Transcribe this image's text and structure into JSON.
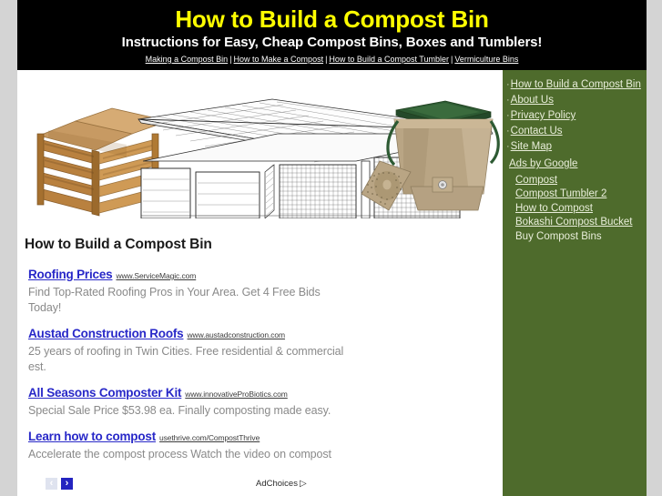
{
  "header": {
    "title": "How to Build a Compost Bin",
    "subtitle": "Instructions for Easy, Cheap Compost Bins, Boxes and Tumblers!",
    "nav": [
      {
        "label": "Making a Compost Bin"
      },
      {
        "label": "How to Make a Compost"
      },
      {
        "label": "How to Build a Compost Tumbler"
      },
      {
        "label": "Vermiculture Bins"
      }
    ],
    "nav_separator": "|",
    "title_color": "#ffff00",
    "background_color": "#000000"
  },
  "sidebar": {
    "background_color": "#4e6b2c",
    "bullet": "·",
    "links": [
      {
        "label": "How to Build a Compost Bin"
      },
      {
        "label": "About Us"
      },
      {
        "label": "Privacy Policy"
      },
      {
        "label": "Contact Us"
      },
      {
        "label": "Site Map"
      }
    ],
    "ads_heading": "Ads by Google",
    "ad_links": [
      {
        "label": "Compost",
        "underlined": true
      },
      {
        "label": "Compost Tumbler 2",
        "underlined": true
      },
      {
        "label": "How to Compost",
        "underlined": true
      },
      {
        "label": "Bokashi Compost Bucket",
        "underlined": true
      },
      {
        "label": "Buy Compost Bins",
        "underlined": false
      }
    ]
  },
  "main": {
    "page_title": "How to Build a Compost Bin",
    "banner_alt": "Three compost bin photos: wooden slatted bin, wire mesh three-bay bin diagram, tan Bokashi compost bucket with green lid",
    "ads": [
      {
        "title": "Roofing Prices",
        "url": "www.ServiceMagic.com",
        "description": "Find Top-Rated Roofing Pros in Your Area. Get 4 Free Bids Today!"
      },
      {
        "title": "Austad Construction Roofs",
        "url": "www.austadconstruction.com",
        "description": "25 years of roofing in Twin Cities. Free residential & commercial est."
      },
      {
        "title": "All Seasons Composter Kit",
        "url": "www.innovativeProBiotics.com",
        "description": "Special Sale Price $53.98 ea. Finally composting made easy."
      },
      {
        "title": "Learn how to compost",
        "url": "usethrive.com/CompostThrive",
        "description": "Accelerate the compost process Watch the video on compost"
      }
    ],
    "ad_footer": {
      "prev_label": "‹",
      "next_label": "›",
      "adchoices_label": "AdChoices",
      "adchoices_icon": "▷"
    }
  }
}
